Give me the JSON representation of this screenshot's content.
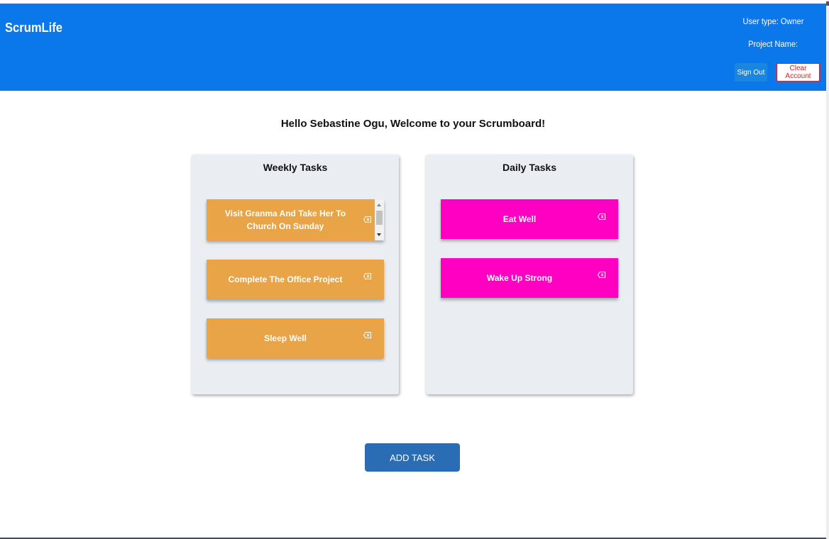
{
  "header": {
    "brand": "ScrumLife",
    "user_type": "User type: Owner",
    "project_name": "Project Name:",
    "sign_out_label": "Sign Out",
    "clear_account_label": "Clear Account",
    "bg_color": "#0a77ea"
  },
  "main": {
    "welcome": "Hello Sebastine Ogu, Welcome to your Scrumboard!",
    "weekly": {
      "title": "Weekly Tasks",
      "color": "#e8a447",
      "tasks": [
        {
          "label": "Visit Granma And Take Her To Church On Sunday",
          "icon": "backspace-icon"
        },
        {
          "label": "Complete The Office Project",
          "icon": "backspace-icon"
        },
        {
          "label": "Sleep Well",
          "icon": "backspace-icon"
        }
      ]
    },
    "daily": {
      "title": "Daily Tasks",
      "color": "#ff00c3",
      "tasks": [
        {
          "label": "Eat Well",
          "icon": "backspace-icon"
        },
        {
          "label": "Wake Up Strong",
          "icon": "backspace-icon"
        }
      ]
    },
    "add_task_label": "ADD TASK"
  }
}
